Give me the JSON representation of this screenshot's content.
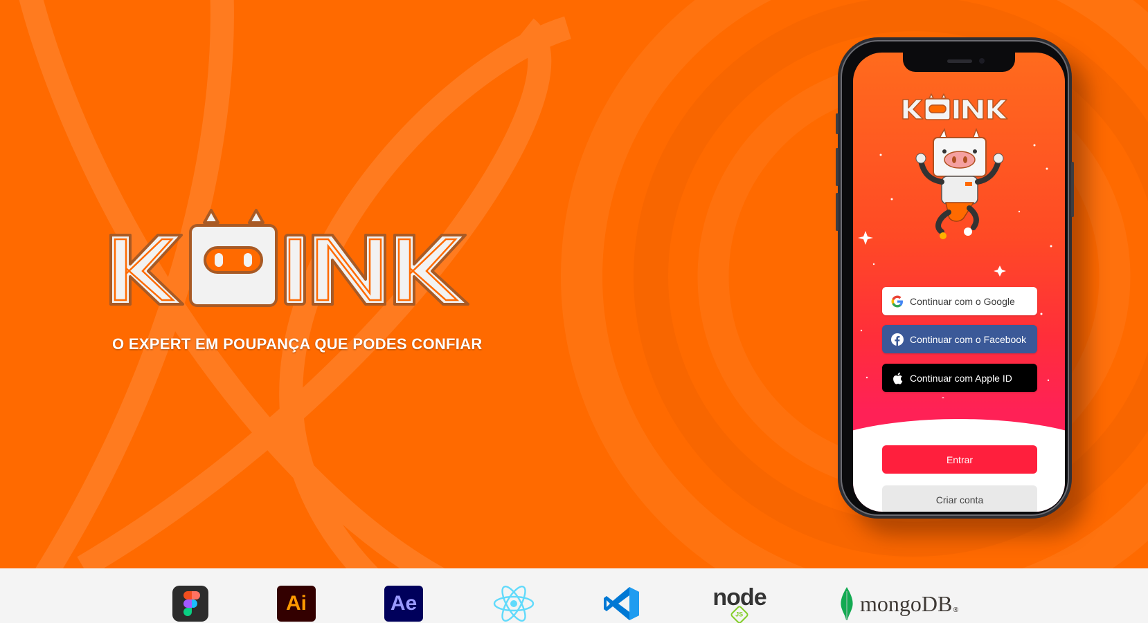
{
  "hero": {
    "brand_name": "KOINK",
    "tagline": "O EXPERT EM POUPANÇA QUE PODES CONFIAR"
  },
  "phone": {
    "app_name": "KOINK",
    "buttons": {
      "google": "Continuar com o Google",
      "facebook": "Continuar com o Facebook",
      "apple": "Continuar com Apple ID",
      "entrar": "Entrar",
      "criar_conta": "Criar conta"
    }
  },
  "tools": [
    {
      "name": "figma-icon"
    },
    {
      "name": "illustrator-icon",
      "label": "Ai"
    },
    {
      "name": "after-effects-icon",
      "label": "Ae"
    },
    {
      "name": "react-icon"
    },
    {
      "name": "vscode-icon"
    },
    {
      "name": "nodejs-icon",
      "label": "node",
      "sub": "JS"
    },
    {
      "name": "mongodb-icon",
      "label": "mongoDB",
      "mark": "®"
    }
  ],
  "colors": {
    "hero_orange": "#ff6a00",
    "facebook_blue": "#3b5998",
    "entrar_red": "#ff1f3d",
    "toolbar_bg": "#f4f4f4"
  }
}
